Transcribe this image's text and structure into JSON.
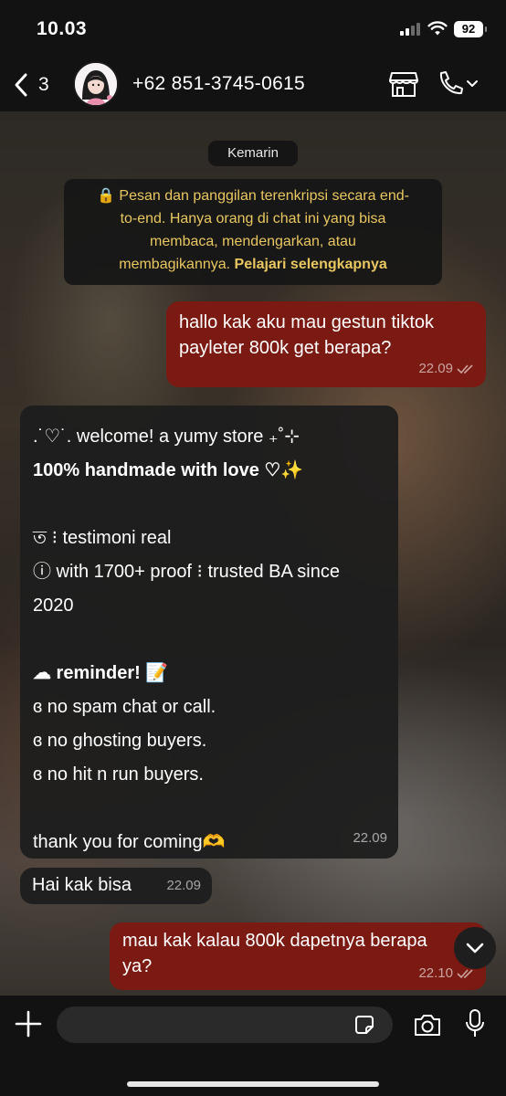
{
  "status_bar": {
    "time": "10.03",
    "battery": "92"
  },
  "header": {
    "unread_count": "3",
    "contact_name": "+62 851-3745-0615"
  },
  "date_chip": "Kemarin",
  "e2e_notice": {
    "line1": "🔒 Pesan dan panggilan terenkripsi secara end-",
    "line2": "to-end. Hanya orang di chat ini yang bisa",
    "line3": "membaca, mendengarkan, atau",
    "line4_prefix": "membagikannya. ",
    "learn_more": "Pelajari selengkapnya"
  },
  "messages": [
    {
      "direction": "out",
      "line1": "hallo kak aku mau gestun tiktok",
      "line2": "payleter 800k get berapa?",
      "time": "22.09"
    },
    {
      "direction": "in",
      "lines": [
        ".˙♡˙. welcome! a yumy store ₊˚⊹",
        " 100% handmade with love ♡✨",
        "",
        "ত ⁝ testimoni real",
        "ⓘ with 1700+ proof ⁝ trusted BA since",
        "2020",
        "",
        "☁ reminder! 📝",
        "ɞ no spam chat or call.",
        "ɞ no ghosting buyers.",
        "ɞ no hit n run buyers.",
        "",
        "thank you for coming🫶"
      ],
      "time": "22.09"
    },
    {
      "direction": "in",
      "text": "Hai kak bisa",
      "time": "22.09"
    },
    {
      "direction": "out",
      "line1": "mau kak kalau 800k dapetnya berapa",
      "line2": "ya?",
      "time": "22.10"
    }
  ],
  "input": {
    "placeholder": ""
  },
  "colors": {
    "outgoing_bubble": "#7a1a12",
    "incoming_bubble": "#1e1e1e",
    "notice_text": "#e9c760"
  }
}
